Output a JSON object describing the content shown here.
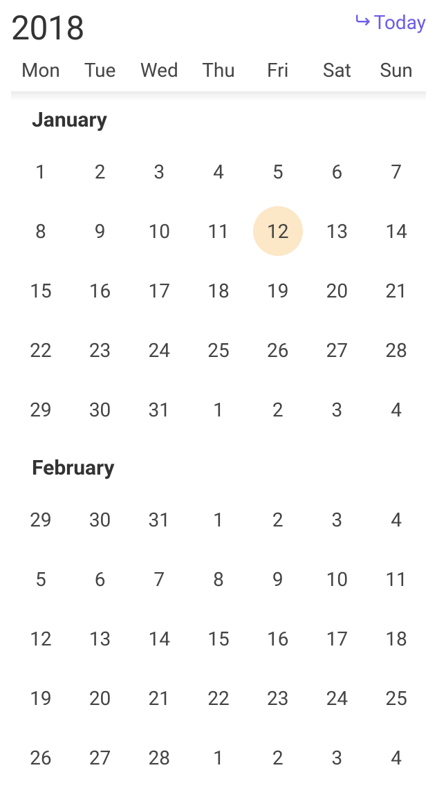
{
  "header": {
    "year": "2018",
    "today_label": "Today"
  },
  "weekdays": [
    "Mon",
    "Tue",
    "Wed",
    "Thu",
    "Fri",
    "Sat",
    "Sun"
  ],
  "months": [
    {
      "name": "January",
      "selected_index": 11,
      "days": [
        1,
        2,
        3,
        4,
        5,
        6,
        7,
        8,
        9,
        10,
        11,
        12,
        13,
        14,
        15,
        16,
        17,
        18,
        19,
        20,
        21,
        22,
        23,
        24,
        25,
        26,
        27,
        28,
        29,
        30,
        31,
        1,
        2,
        3,
        4
      ]
    },
    {
      "name": "February",
      "selected_index": -1,
      "days": [
        29,
        30,
        31,
        1,
        2,
        3,
        4,
        5,
        6,
        7,
        8,
        9,
        10,
        11,
        12,
        13,
        14,
        15,
        16,
        17,
        18,
        19,
        20,
        21,
        22,
        23,
        24,
        25,
        26,
        27,
        28,
        1,
        2,
        3,
        4
      ]
    }
  ],
  "colors": {
    "accent": "#6c5ce7",
    "highlight_bg": "#fce7c7"
  }
}
